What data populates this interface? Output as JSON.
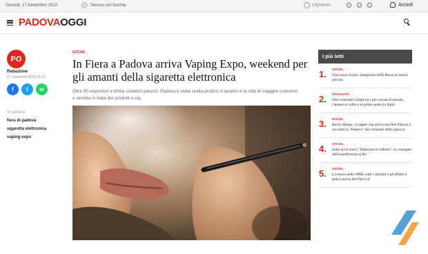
{
  "topbar": {
    "date": "Giovedì, 17 Novembre 2022",
    "weather_text": "Sereno con foschia",
    "brand": "citynews",
    "login_label": "Accedi"
  },
  "header": {
    "logo_part1": "PADOVA",
    "logo_part2": "OGGI"
  },
  "author": {
    "avatar_text": "PO",
    "name": "Redazione",
    "time": "17 novembre 2022 14:23"
  },
  "share": {
    "facebook": "f",
    "twitter": "t",
    "whatsapp": "w"
  },
  "tags": {
    "label": "Si parla di",
    "items": [
      "fiera di padova",
      "sigaretta elettronica",
      "vaping expo"
    ]
  },
  "article": {
    "category": "SOCIAL",
    "headline": "In Fiera a Padova arriva Vaping Expo, weekend per gli amanti della sigaretta elettronica",
    "lead": "Oltre 90 espositori e 6mila visitatori previsti: Padova è stata scelta proprio in quanto è la città di maggior consumo e vendita in Italia dei prodotti e-cig"
  },
  "sidebar": {
    "title": "I più letti",
    "items": [
      {
        "num": "1.",
        "category": "SOCIAL",
        "text": "Una vasca in più: inaugurata nella Bassa la nuova piscina"
      },
      {
        "num": "2.",
        "category": "ATTUALITÀ",
        "text": "Otto ristoranti Unipd tra i più cercati al mondo, l'ateneo si colloca al primo posto in Italia"
      },
      {
        "num": "3.",
        "category": "PIAZZE",
        "text": "Kevin Mopac, il rapper che arriva dai Due Palazzi e racconta la \"Padova\" dei criminali dello spaccio"
      },
      {
        "num": "4.",
        "category": "SOCIAL",
        "text": "Sono nove nuovi \"Padovani eccellenti\": la consegna dell'onorificenza al Bo"
      },
      {
        "num": "5.",
        "category": "SOCIAL",
        "text": "La nuova sede SIMS, tutti i sintomi e gli effetti il polo Lancisi del Parco di"
      }
    ]
  },
  "colors": {
    "accent": "#e0261b",
    "sidebar_header": "#4a4a4a",
    "facebook": "#1877f2",
    "twitter": "#1da1f2",
    "whatsapp": "#25d366"
  },
  "icons": [
    "menu-icon",
    "search-icon",
    "user-icon",
    "weather-icon",
    "citynews-icon",
    "facebook-icon",
    "twitter-icon",
    "whatsapp-icon"
  ]
}
